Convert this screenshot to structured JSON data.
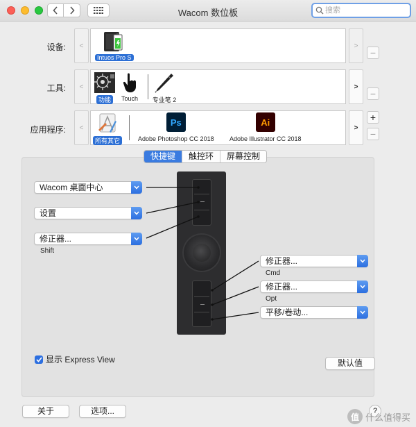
{
  "window": {
    "title": "Wacom 数位板",
    "search_placeholder": "搜索"
  },
  "device_row": {
    "label": "设备:",
    "items": [
      {
        "name": "Intuos Pro S",
        "icon": "tablet-battery-icon",
        "selected": true
      }
    ]
  },
  "tool_row": {
    "label": "工具:",
    "items": [
      {
        "name": "功能",
        "icon": "function-icon",
        "selected": true
      },
      {
        "name": "Touch",
        "icon": "touch-hand-icon",
        "selected": false
      },
      {
        "name": "专业笔 2",
        "icon": "pro-pen-icon",
        "selected": false
      }
    ]
  },
  "app_row": {
    "label": "应用程序:",
    "items": [
      {
        "name": "所有其它",
        "icon": "all-apps-icon",
        "selected": true
      },
      {
        "name": "Adobe Photoshop CC 2018",
        "icon": "photoshop-icon",
        "badge": "Ps",
        "selected": false
      },
      {
        "name": "Adobe Illustrator CC 2018",
        "icon": "illustrator-icon",
        "badge": "Ai",
        "selected": false
      }
    ]
  },
  "side_buttons": {
    "plus": "+",
    "minus": "−"
  },
  "tabs": [
    {
      "label": "快捷键",
      "active": true
    },
    {
      "label": "触控环",
      "active": false
    },
    {
      "label": "屏幕控制",
      "active": false
    }
  ],
  "left_keys": [
    {
      "value": "Wacom 桌面中心",
      "sub": ""
    },
    {
      "value": "设置",
      "sub": ""
    },
    {
      "value": "修正器...",
      "sub": "Shift"
    }
  ],
  "right_keys": [
    {
      "value": "修正器...",
      "sub": "Cmd"
    },
    {
      "value": "修正器...",
      "sub": "Opt"
    },
    {
      "value": "平移/卷动...",
      "sub": ""
    }
  ],
  "express_view": {
    "label": "显示 Express View",
    "checked": true
  },
  "buttons": {
    "defaults": "默认值",
    "about": "关于",
    "options": "选项...",
    "help": "?"
  },
  "watermark": {
    "text": "什么值得买",
    "icon_char": "值"
  },
  "colors": {
    "accent": "#2c6fe0",
    "tablet": "#2d2d2f",
    "ps_bg": "#001e36",
    "ps_fg": "#31a8ff",
    "ai_bg": "#330000",
    "ai_fg": "#ff9a00"
  }
}
